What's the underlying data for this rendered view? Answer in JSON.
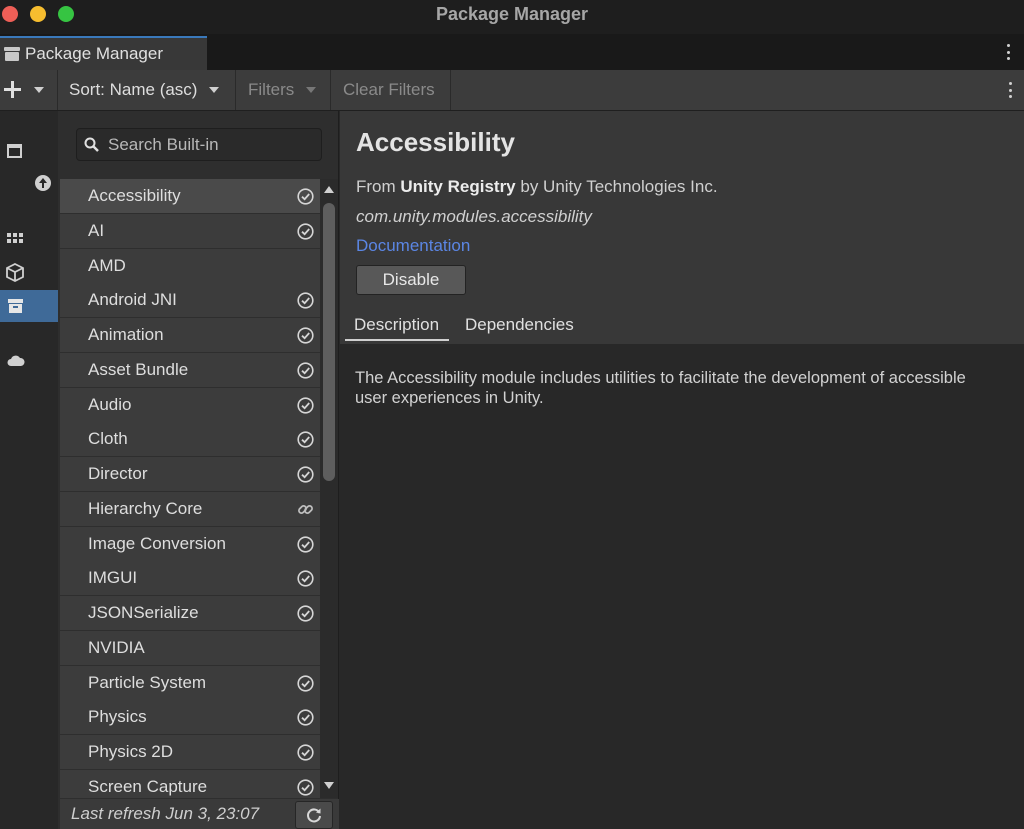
{
  "window": {
    "title": "Package Manager"
  },
  "tab": {
    "label": "Package Manager",
    "icon": "package-manager-icon"
  },
  "toolbar": {
    "add_icon": "plus-icon",
    "sort_label": "Sort: Name (asc)",
    "filters_label": "Filters",
    "clear_filters_label": "Clear Filters"
  },
  "sidebar": {
    "items": [
      {
        "icon": "in-project-icon",
        "active": false
      },
      {
        "icon": "updates-icon",
        "active": false
      },
      {
        "icon": "unity-registry-icon",
        "active": false
      },
      {
        "icon": "my-assets-icon",
        "active": false
      },
      {
        "icon": "built-in-icon",
        "active": true
      },
      {
        "icon": "services-icon",
        "active": false
      }
    ]
  },
  "search": {
    "placeholder": "Search Built-in",
    "value": ""
  },
  "packages": [
    {
      "label": "Accessibility",
      "status": "check",
      "selected": true
    },
    {
      "label": "AI",
      "status": "check"
    },
    {
      "label": "AMD",
      "status": "none"
    },
    {
      "label": "Android JNI",
      "status": "check"
    },
    {
      "label": "Animation",
      "status": "check"
    },
    {
      "label": "Asset Bundle",
      "status": "check"
    },
    {
      "label": "Audio",
      "status": "check"
    },
    {
      "label": "Cloth",
      "status": "check"
    },
    {
      "label": "Director",
      "status": "check"
    },
    {
      "label": "Hierarchy Core",
      "status": "link"
    },
    {
      "label": "Image Conversion",
      "status": "check"
    },
    {
      "label": "IMGUI",
      "status": "check"
    },
    {
      "label": "JSONSerialize",
      "status": "check"
    },
    {
      "label": "NVIDIA",
      "status": "none"
    },
    {
      "label": "Particle System",
      "status": "check"
    },
    {
      "label": "Physics",
      "status": "check"
    },
    {
      "label": "Physics 2D",
      "status": "check"
    },
    {
      "label": "Screen Capture",
      "status": "check"
    }
  ],
  "footer": {
    "last_refresh": "Last refresh Jun 3, 23:07"
  },
  "detail": {
    "title": "Accessibility",
    "from_prefix": "From ",
    "registry": "Unity Registry",
    "by_text": " by Unity Technologies Inc.",
    "package_id": "com.unity.modules.accessibility",
    "documentation_link": "Documentation",
    "disable_label": "Disable",
    "tabs": [
      {
        "label": "Description",
        "active": true
      },
      {
        "label": "Dependencies",
        "active": false
      }
    ],
    "description": "The Accessibility module includes utilities to facilitate the development of accessible user experiences in Unity."
  },
  "colors": {
    "accent": "#3a79bb",
    "selected_sidebar": "#3f6a98",
    "link": "#5b86e4"
  }
}
